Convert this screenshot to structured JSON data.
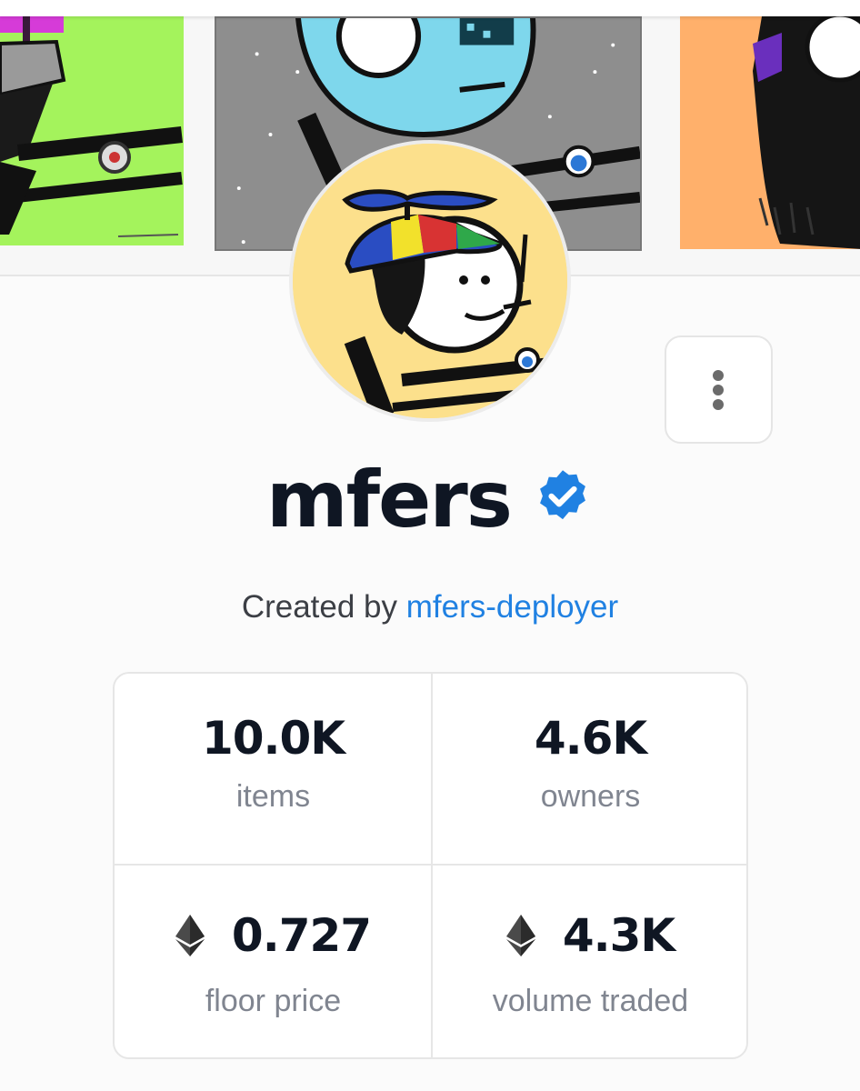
{
  "collection": {
    "name": "mfers",
    "verified": true,
    "creator_prefix": "Created by",
    "creator_name": "mfers-deployer"
  },
  "stats": [
    {
      "value": "10.0K",
      "label": "items",
      "currency_icon": "none"
    },
    {
      "value": "4.6K",
      "label": "owners",
      "currency_icon": "none"
    },
    {
      "value": "0.727",
      "label": "floor price",
      "currency_icon": "ethereum-icon"
    },
    {
      "value": "4.3K",
      "label": "volume traded",
      "currency_icon": "ethereum-icon"
    }
  ],
  "colors": {
    "accent": "#2081e2",
    "verified_badge": "#2081e2",
    "title": "#0f1623",
    "label": "#808590",
    "avatar_background": "#fce08c"
  },
  "icons": {
    "menu": "more-vertical-icon",
    "verified": "verified-badge-icon",
    "currency": "ethereum-icon"
  }
}
